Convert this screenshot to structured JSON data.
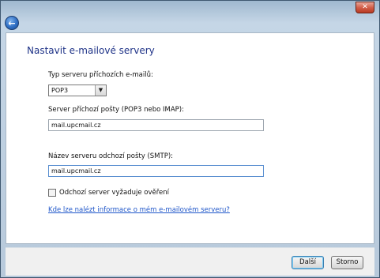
{
  "window": {
    "close_label": "✕",
    "back_label": "←"
  },
  "dialog": {
    "heading": "Nastavit e-mailové servery",
    "incoming_type_label": "Typ serveru příchozích e-mailů:",
    "incoming_type_value": "POP3",
    "incoming_server_label": "Server příchozí pošty (POP3 nebo IMAP):",
    "incoming_server_value": "mail.upcmail.cz",
    "outgoing_server_label": "Název serveru odchozí pošty (SMTP):",
    "outgoing_server_value": "mail.upcmail.cz",
    "auth_checkbox_label": "Odchozí server vyžaduje ověření",
    "auth_checked": false,
    "help_link": "Kde lze nalézt informace o mém e-mailovém serveru?"
  },
  "footer": {
    "next_label": "Další",
    "cancel_label": "Storno"
  },
  "colors": {
    "heading": "#1e3287",
    "link": "#1f56c9",
    "close": "#c44a32"
  }
}
